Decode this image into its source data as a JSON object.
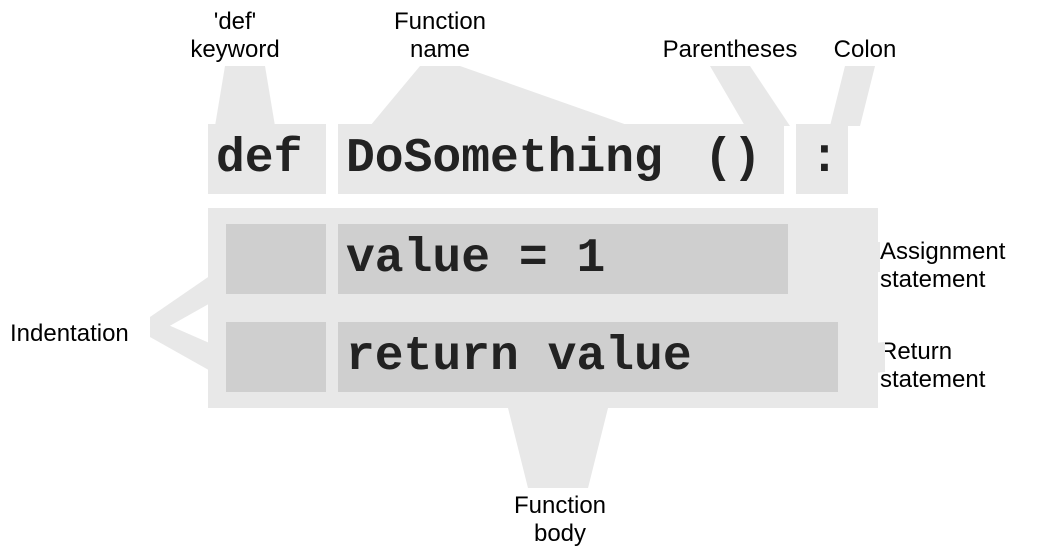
{
  "labels": {
    "def_keyword_line1": "'def'",
    "def_keyword_line2": "keyword",
    "function_name_line1": "Function",
    "function_name_line2": "name",
    "parentheses": "Parentheses",
    "colon": "Colon",
    "indentation": "Indentation",
    "assignment_line1": "Assignment",
    "assignment_line2": "statement",
    "return_line1": "Return",
    "return_line2": "statement",
    "function_body_line1": "Function",
    "function_body_line2": "body"
  },
  "code": {
    "def": "def",
    "name": "DoSomething",
    "parens": "()",
    "colon": ":",
    "assign": "value = 1",
    "ret": "return value"
  }
}
